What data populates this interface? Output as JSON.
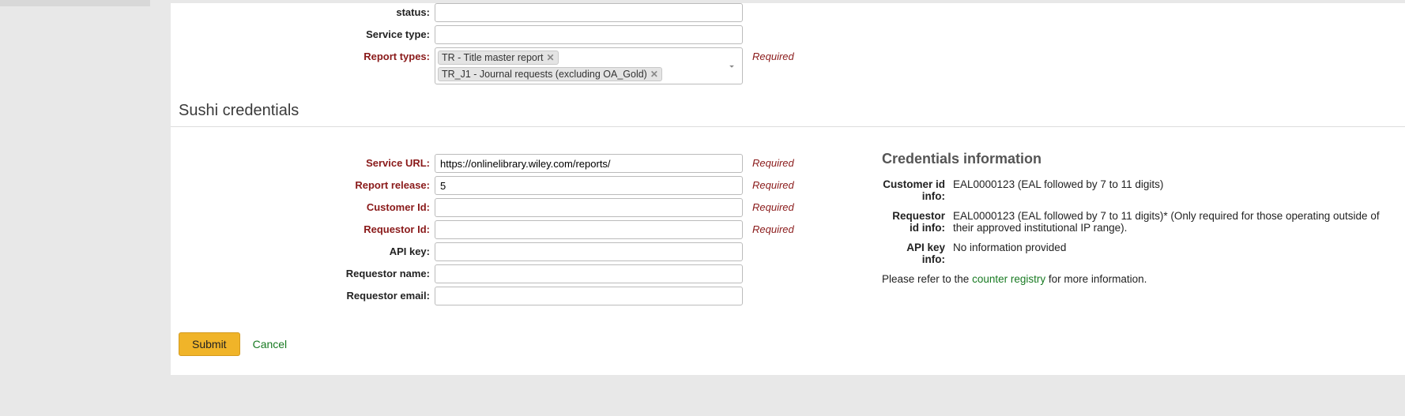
{
  "labels": {
    "status": "status:",
    "service_type": "Service type:",
    "report_types": "Report types:",
    "service_url": "Service URL:",
    "report_release": "Report release:",
    "customer_id": "Customer Id:",
    "requestor_id": "Requestor Id:",
    "api_key": "API key:",
    "requestor_name": "Requestor name:",
    "requestor_email": "Requestor email:"
  },
  "values": {
    "status": "",
    "service_type": "",
    "service_url": "https://onlinelibrary.wiley.com/reports/",
    "report_release": "5",
    "customer_id": "",
    "requestor_id": "",
    "api_key": "",
    "requestor_name": "",
    "requestor_email": ""
  },
  "report_types": {
    "tags": [
      "TR - Title master report",
      "TR_J1 - Journal requests (excluding OA_Gold)"
    ]
  },
  "required_text": "Required",
  "section_head": "Sushi credentials",
  "credentials": {
    "head": "Credentials information",
    "rows": {
      "customer_id": {
        "label": "Customer id info:",
        "value": "EAL0000123 (EAL followed by 7 to 11 digits)"
      },
      "requestor_id": {
        "label": "Requestor id info:",
        "value": "EAL0000123 (EAL followed by 7 to 11 digits)* (Only required for those operating outside of their approved institutional IP range)."
      },
      "api_key": {
        "label": "API key info:",
        "value": "No information provided"
      }
    },
    "footer_pre": "Please refer to the ",
    "footer_link": "counter registry",
    "footer_post": " for more information."
  },
  "buttons": {
    "submit": "Submit",
    "cancel": "Cancel"
  }
}
